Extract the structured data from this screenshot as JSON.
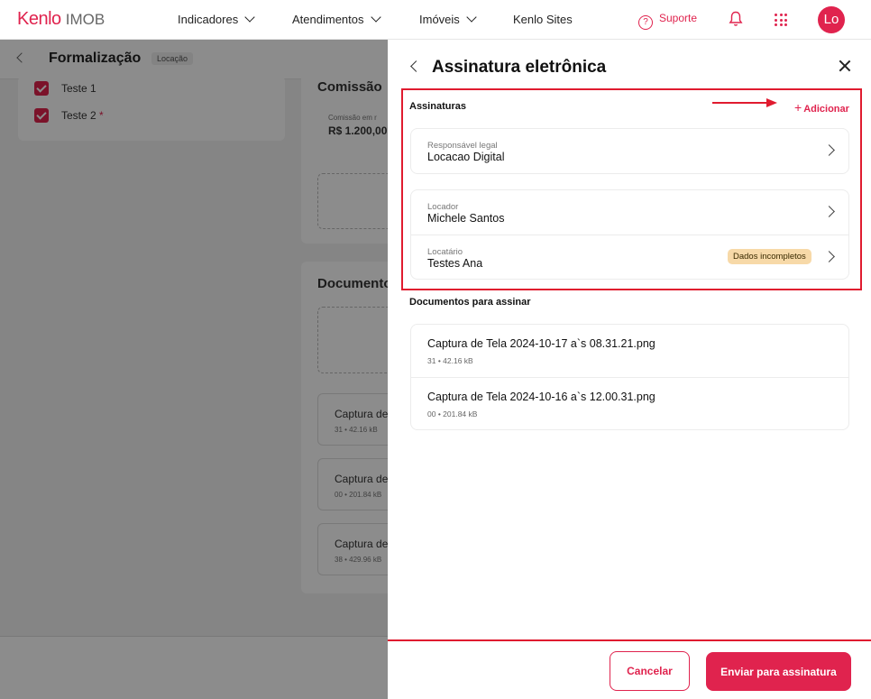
{
  "topnav": {
    "logo_brand": "Kenlo",
    "logo_product": "IMOB",
    "links": [
      "Indicadores",
      "Atendimentos",
      "Imóveis",
      "Kenlo Sites"
    ],
    "support_label": "Suporte",
    "avatar_initials": "Lo"
  },
  "background": {
    "page_title": "Formalização",
    "page_tag": "Locação",
    "checklist": [
      "Teste 1",
      "Teste 2"
    ],
    "required_mark": "*",
    "commission_heading": "Comissão",
    "commission_label": "Comissão em r",
    "commission_value": "R$ 1.200,00",
    "documents_heading": "Documento",
    "files": [
      {
        "name": "Captura de",
        "meta": "31 • 42.16 kB"
      },
      {
        "name": "Captura de",
        "meta": "00 • 201.84 kB"
      },
      {
        "name": "Captura de",
        "meta": "38 • 429.96 kB"
      }
    ]
  },
  "drawer": {
    "title": "Assinatura eletrônica",
    "signatures_label": "Assinaturas",
    "add_label": "Adicionar",
    "signers": [
      {
        "role": "Responsável legal",
        "name": "Locacao Digital"
      },
      {
        "role": "Locador",
        "name": "Michele Santos"
      },
      {
        "role": "Locatário",
        "name": "Testes Ana",
        "badge": "Dados incompletos"
      }
    ],
    "documents_label": "Documentos para assinar",
    "documents": [
      {
        "name": "Captura de Tela 2024-10-17 a`s 08.31.21.png",
        "meta": "31 • 42.16 kB"
      },
      {
        "name": "Captura de Tela 2024-10-16 a`s 12.00.31.png",
        "meta": "00 • 201.84 kB"
      }
    ],
    "cancel_label": "Cancelar",
    "send_label": "Enviar para assinatura"
  },
  "colors": {
    "brand": "#e0234e",
    "annotation_red": "#e01b2f",
    "badge_bg": "#f7d9a8"
  }
}
